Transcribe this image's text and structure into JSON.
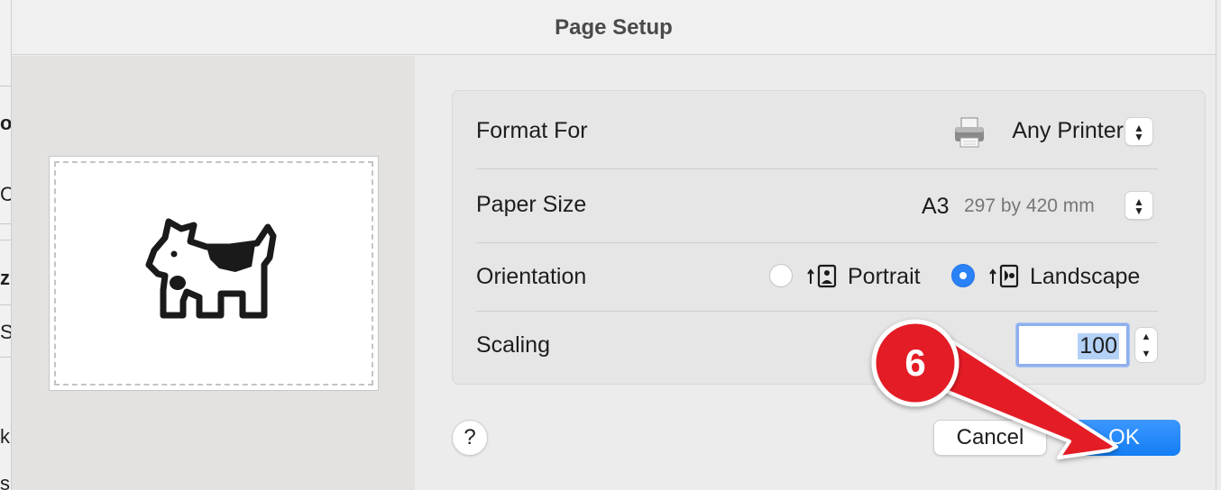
{
  "dialog": {
    "title": "Page Setup"
  },
  "format_for": {
    "label": "Format For",
    "value": "Any Printer",
    "icon": "printer-icon"
  },
  "paper_size": {
    "label": "Paper Size",
    "value": "A3",
    "dimensions": "297 by 420 mm"
  },
  "orientation": {
    "label": "Orientation",
    "options": [
      {
        "label": "Portrait",
        "selected": false,
        "icon": "portrait-orientation-icon"
      },
      {
        "label": "Landscape",
        "selected": true,
        "icon": "landscape-orientation-icon"
      }
    ]
  },
  "scaling": {
    "label": "Scaling",
    "value": "100"
  },
  "buttons": {
    "help": "?",
    "cancel": "Cancel",
    "ok": "OK"
  },
  "annotation": {
    "step": "6",
    "color": "#e41e26"
  },
  "background_fragments": [
    "o",
    "C",
    "z",
    "Si",
    "k",
    "s"
  ],
  "colors": {
    "accent": "#1a84f7",
    "preview_bg": "#e3e2e0",
    "panel_bg": "#e6e6e6"
  }
}
